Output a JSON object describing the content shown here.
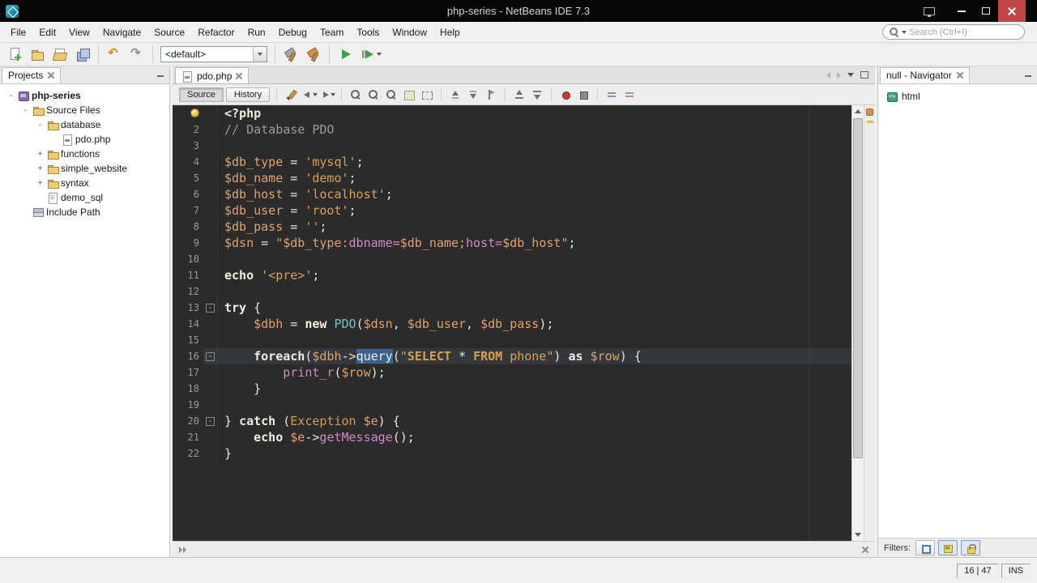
{
  "window": {
    "title": "php-series - NetBeans IDE 7.3",
    "controls": [
      {
        "name": "display-settings",
        "type": "monitor"
      },
      {
        "name": "minimize",
        "type": "minimize"
      },
      {
        "name": "maximize",
        "type": "maximize"
      },
      {
        "name": "close",
        "type": "close"
      }
    ]
  },
  "menubar": {
    "items": [
      "File",
      "Edit",
      "View",
      "Navigate",
      "Source",
      "Refactor",
      "Run",
      "Debug",
      "Team",
      "Tools",
      "Window",
      "Help"
    ],
    "search_placeholder": "Search (Ctrl+I)"
  },
  "toolbar": {
    "config_value": "<default>",
    "groups": [
      [
        {
          "name": "new-file",
          "icon": "page-plus"
        },
        {
          "name": "new-project",
          "icon": "folder-new"
        },
        {
          "name": "open-project",
          "icon": "folder-open"
        },
        {
          "name": "save-all",
          "icon": "disks"
        }
      ],
      [
        {
          "name": "undo",
          "icon": "undo"
        },
        {
          "name": "redo",
          "icon": "redo"
        }
      ],
      [
        {
          "name": "config-select",
          "type": "combo"
        }
      ],
      [
        {
          "name": "build-project",
          "icon": "hammer"
        },
        {
          "name": "clean-build-project",
          "icon": "hammer-clean"
        }
      ],
      [
        {
          "name": "run-project",
          "icon": "run"
        },
        {
          "name": "debug-project",
          "icon": "debug",
          "dropdown": true
        }
      ]
    ]
  },
  "projects_panel": {
    "tab_label": "Projects",
    "tree": [
      {
        "label": "php-series",
        "level": 0,
        "toggle": "-",
        "icon": "php-project",
        "bold": true
      },
      {
        "label": "Source Files",
        "level": 1,
        "toggle": "-",
        "icon": "folder"
      },
      {
        "label": "database",
        "level": 2,
        "toggle": "-",
        "icon": "folder"
      },
      {
        "label": "pdo.php",
        "level": 3,
        "toggle": "",
        "icon": "php-file"
      },
      {
        "label": "functions",
        "level": 2,
        "toggle": "+",
        "icon": "folder"
      },
      {
        "label": "simple_website",
        "level": 2,
        "toggle": "+",
        "icon": "folder"
      },
      {
        "label": "syntax",
        "level": 2,
        "toggle": "+",
        "icon": "folder"
      },
      {
        "label": "demo_sql",
        "level": 2,
        "toggle": "",
        "icon": "file"
      },
      {
        "label": "Include Path",
        "level": 1,
        "toggle": "",
        "icon": "library"
      }
    ]
  },
  "editor": {
    "tab": "pdo.php",
    "caret_line": 16,
    "fold_glyph": "-",
    "toolbar": {
      "source_label": "Source",
      "history_label": "History",
      "icons": [
        {
          "name": "last-edit"
        },
        {
          "name": "back",
          "dropdown": true
        },
        {
          "name": "forward",
          "dropdown": true
        },
        {
          "name": "find-selection",
          "sep": true
        },
        {
          "name": "find-previous"
        },
        {
          "name": "find-next"
        },
        {
          "name": "toggle-highlight"
        },
        {
          "name": "rectangular-selection"
        },
        {
          "name": "previous-bookmark",
          "sep": true
        },
        {
          "name": "next-bookmark"
        },
        {
          "name": "toggle-bookmark"
        },
        {
          "name": "previous-occurrence",
          "sep": true
        },
        {
          "name": "next-occurrence"
        },
        {
          "name": "record-macro",
          "sep": true
        },
        {
          "name": "stop-macro"
        },
        {
          "name": "comment",
          "sep": true
        },
        {
          "name": "uncomment"
        }
      ]
    },
    "lines": [
      {
        "n": 1,
        "bulb": true,
        "t": [
          [
            "k",
            "<?php"
          ]
        ]
      },
      {
        "n": 2,
        "t": [
          [
            "c",
            "// Database PDO"
          ]
        ]
      },
      {
        "n": 3,
        "t": []
      },
      {
        "n": 4,
        "t": [
          [
            "v",
            "$db_type"
          ],
          [
            "p",
            " = "
          ],
          [
            "s",
            "'mysql'"
          ],
          [
            "p",
            ";"
          ]
        ]
      },
      {
        "n": 5,
        "t": [
          [
            "v",
            "$db_name"
          ],
          [
            "p",
            " = "
          ],
          [
            "s",
            "'demo'"
          ],
          [
            "p",
            ";"
          ]
        ]
      },
      {
        "n": 6,
        "t": [
          [
            "v",
            "$db_host"
          ],
          [
            "p",
            " = "
          ],
          [
            "s",
            "'localhost'"
          ],
          [
            "p",
            ";"
          ]
        ]
      },
      {
        "n": 7,
        "t": [
          [
            "v",
            "$db_user"
          ],
          [
            "p",
            " = "
          ],
          [
            "s",
            "'root'"
          ],
          [
            "p",
            ";"
          ]
        ]
      },
      {
        "n": 8,
        "t": [
          [
            "v",
            "$db_pass"
          ],
          [
            "p",
            " = "
          ],
          [
            "s",
            "''"
          ],
          [
            "p",
            ";"
          ]
        ]
      },
      {
        "n": 9,
        "t": [
          [
            "v",
            "$dsn"
          ],
          [
            "p",
            " = "
          ],
          [
            "s",
            "\""
          ],
          [
            "v",
            "$db_type"
          ],
          [
            "s",
            ":"
          ],
          [
            "m",
            "dbname="
          ],
          [
            "v",
            "$db_name"
          ],
          [
            "s",
            ";"
          ],
          [
            "m",
            "host="
          ],
          [
            "v",
            "$db_host"
          ],
          [
            "s",
            "\""
          ],
          [
            "p",
            ";"
          ]
        ]
      },
      {
        "n": 10,
        "t": []
      },
      {
        "n": 11,
        "t": [
          [
            "k",
            "echo"
          ],
          [
            "p",
            " "
          ],
          [
            "s",
            "'<pre>'"
          ],
          [
            "p",
            ";"
          ]
        ]
      },
      {
        "n": 12,
        "t": []
      },
      {
        "n": 13,
        "fold": true,
        "t": [
          [
            "k",
            "try"
          ],
          [
            "p",
            " {"
          ]
        ]
      },
      {
        "n": 14,
        "t": [
          [
            "p",
            "    "
          ],
          [
            "v",
            "$dbh"
          ],
          [
            "p",
            " = "
          ],
          [
            "k",
            "new"
          ],
          [
            "p",
            " "
          ],
          [
            "t",
            "PDO"
          ],
          [
            "p",
            "("
          ],
          [
            "v",
            "$dsn"
          ],
          [
            "p",
            ", "
          ],
          [
            "v",
            "$db_user"
          ],
          [
            "p",
            ", "
          ],
          [
            "v",
            "$db_pass"
          ],
          [
            "p",
            ");"
          ]
        ]
      },
      {
        "n": 15,
        "t": []
      },
      {
        "n": 16,
        "fold": true,
        "t": [
          [
            "p",
            "    "
          ],
          [
            "k",
            "foreach"
          ],
          [
            "p",
            "("
          ],
          [
            "v",
            "$dbh"
          ],
          [
            "p",
            "->"
          ],
          [
            "fo",
            "query"
          ],
          [
            "p",
            "("
          ],
          [
            "s",
            "\""
          ],
          [
            "sk",
            "SELECT"
          ],
          [
            "s",
            " "
          ],
          [
            "p",
            "*"
          ],
          [
            "s",
            " "
          ],
          [
            "sk",
            "FROM"
          ],
          [
            "s",
            " phone\""
          ],
          [
            "p",
            ") "
          ],
          [
            "k",
            "as"
          ],
          [
            "p",
            " "
          ],
          [
            "v",
            "$row"
          ],
          [
            "p",
            ") {"
          ]
        ]
      },
      {
        "n": 17,
        "t": [
          [
            "p",
            "        "
          ],
          [
            "f",
            "print_r"
          ],
          [
            "p",
            "("
          ],
          [
            "v",
            "$row"
          ],
          [
            "p",
            ");"
          ]
        ]
      },
      {
        "n": 18,
        "t": [
          [
            "p",
            "    }"
          ]
        ]
      },
      {
        "n": 19,
        "t": []
      },
      {
        "n": 20,
        "fold": true,
        "t": [
          [
            "p",
            "} "
          ],
          [
            "k",
            "catch"
          ],
          [
            "p",
            " ("
          ],
          [
            "e",
            "Exception"
          ],
          [
            "p",
            " "
          ],
          [
            "v",
            "$e"
          ],
          [
            "p",
            ") {"
          ]
        ]
      },
      {
        "n": 21,
        "t": [
          [
            "p",
            "    "
          ],
          [
            "k",
            "echo"
          ],
          [
            "p",
            " "
          ],
          [
            "v",
            "$e"
          ],
          [
            "p",
            "->"
          ],
          [
            "f",
            "getMessage"
          ],
          [
            "p",
            "();"
          ]
        ]
      },
      {
        "n": 22,
        "t": [
          [
            "p",
            "}"
          ]
        ]
      }
    ]
  },
  "navigator": {
    "tab_label": "null - Navigator",
    "items": [
      {
        "label": "html",
        "icon": "html"
      }
    ],
    "filters": {
      "label": "Filters:",
      "buttons": [
        {
          "name": "show-inherited-filter",
          "on": false
        },
        {
          "name": "show-attributes-filter",
          "on": true
        },
        {
          "name": "show-content-filter",
          "on": true
        }
      ]
    }
  },
  "statusbar": {
    "caret_position": "16 | 47",
    "insert_mode": "INS"
  },
  "colors": {
    "editor_bg": "#2b2b2b",
    "keyword": "#f0ece0",
    "variable": "#e2a168",
    "string": "#d6a252",
    "comment": "#9b9b9b",
    "function": "#d287c8",
    "type": "#6fc5c5",
    "class_gold": "#c9a24c",
    "occurrence_bg": "#3c618c",
    "close_button": "#c14444"
  }
}
